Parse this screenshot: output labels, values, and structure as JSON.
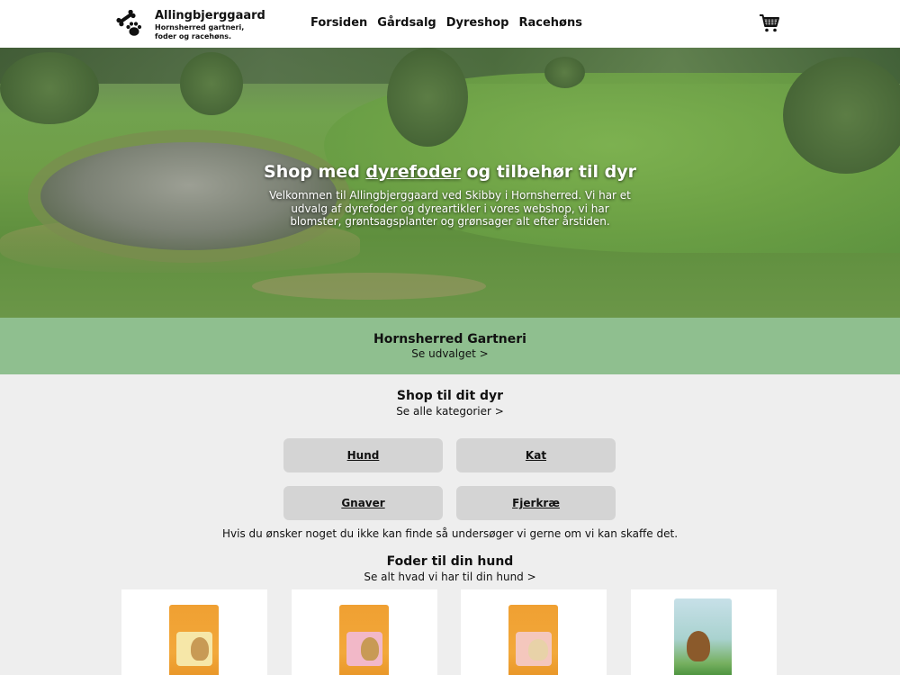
{
  "header": {
    "logo_title": "Allingbjerggaard",
    "logo_subtitle": "Hornsherred gartneri, foder og racehøns.",
    "logo_icon": "paw-bone-icon",
    "cart_icon": "shopping-cart-icon",
    "nav": [
      "Forsiden",
      "Gårdsalg",
      "Dyreshop",
      "Racehøns"
    ]
  },
  "hero": {
    "title_before": "Shop med ",
    "title_link": "dyrefoder",
    "title_after": " og tilbehør til dyr",
    "text": "Velkommen til Allingbjerggaard ved Skibby i Hornsherred. Vi har et udvalg af dyrefoder og dyreartikler i vores webshop, vi har blomster, grøntsagsplanter og grønsager alt efter årstiden."
  },
  "gartneri": {
    "title": "Hornsherred Gartneri",
    "link": "Se udvalget >"
  },
  "shop": {
    "title": "Shop til dit dyr",
    "link": "Se alle kategorier >",
    "categories": [
      "Hund",
      "Kat",
      "Gnaver",
      "Fjerkræ"
    ],
    "notice": "Hvis du ønsker noget du ikke kan finde så undersøger vi gerne om vi kan skaffe det."
  },
  "dog_food": {
    "title": "Foder til din hund",
    "link": "Se alt hvad vi har til din hund >"
  },
  "colors": {
    "band": "#8fbf8f",
    "button": "#d4d4d4",
    "bag_orange": "#f0a032"
  }
}
